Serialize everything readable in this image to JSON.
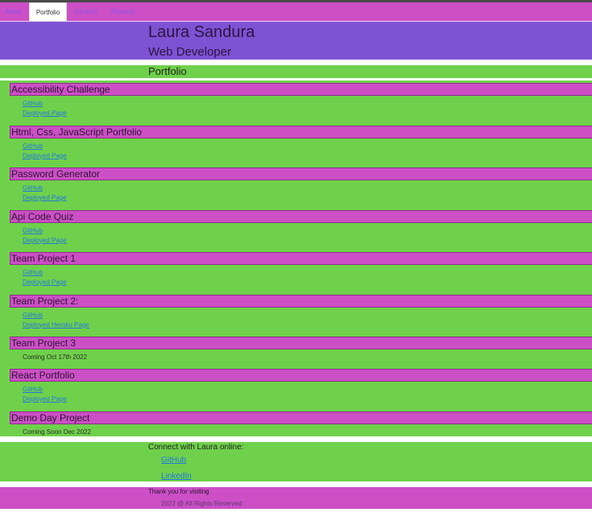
{
  "nav": {
    "tabs": [
      {
        "label": "About",
        "active": false
      },
      {
        "label": "Portfolio",
        "active": true
      },
      {
        "label": "Contact",
        "active": false
      },
      {
        "label": "Resume",
        "active": false
      }
    ]
  },
  "header": {
    "name": "Laura Sandura",
    "role": "Web Developer"
  },
  "portfolio_heading": "Portfolio",
  "projects": [
    {
      "title": "Accessibility Challenge",
      "links": [
        "GitHub",
        "Deployed Page"
      ]
    },
    {
      "title": "Html, Css, JavaScript Portfolio",
      "links": [
        "GitHub",
        "Deployed Page"
      ]
    },
    {
      "title": "Password Generator",
      "links": [
        "GitHub",
        "Deployed Page"
      ]
    },
    {
      "title": "Api Code Quiz",
      "links": [
        "GitHub",
        "Deployed Page"
      ]
    },
    {
      "title": "Team Project 1",
      "links": [
        "GitHub",
        "Deployed Page"
      ]
    },
    {
      "title": "Team Project 2:",
      "links": [
        "GitHub",
        "Deployed Heroku Page"
      ]
    },
    {
      "title": "Team Project 3",
      "note": "Coming Oct 17th 2022"
    },
    {
      "title": "React Portfolio",
      "links": [
        "GitHub",
        "Deployed Page"
      ]
    },
    {
      "title": "Demo Day Project",
      "note": "Coming Soon Dec 2022"
    }
  ],
  "footer": {
    "connect_text": "Connect with Laura online:",
    "links": [
      "GitHub",
      "LinkedIn"
    ]
  },
  "bottom": {
    "thanks": "Thank you for visiting",
    "copyright": "2022 @ All Rights Reserved"
  },
  "colors": {
    "nav_bg": "#cc4fc6",
    "header_bg": "#7f52d4",
    "section_bg": "#6fd14b",
    "link": "#2277dd"
  }
}
